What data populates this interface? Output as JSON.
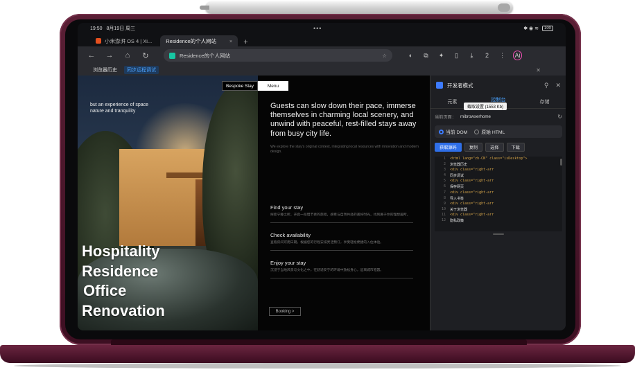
{
  "status": {
    "time": "19:50",
    "date": "8月19日 周三",
    "dots": "•••",
    "signal": "✱ ◉ ≋",
    "battery": "100"
  },
  "tabs": [
    {
      "label": "小米澎湃 OS 4 | Xi...",
      "active": false
    },
    {
      "label": "Residence的个人网站",
      "active": true
    }
  ],
  "toolbar": {
    "url": "Residence的个人网站",
    "icons": [
      "←",
      "→",
      "⌂",
      "↻"
    ],
    "ai_label": "Ai"
  },
  "bookmarks": {
    "items": [
      "浏览器历史",
      "同步远程调试"
    ]
  },
  "hero": {
    "caption_1": "but an experience of space",
    "caption_2": "nature and tranquility",
    "words": [
      "Hospitality",
      "Residence",
      "Office",
      "Renovation"
    ]
  },
  "page_nav": {
    "bespoke": "Bespoke Stay",
    "menu": "Menu"
  },
  "content": {
    "headline": "Guests can slow down their pace, immerse themselves in charming local scenery, and unwind with peaceful, rest-filled stays away from busy city life.",
    "subcopy": "We explore the stay's original context, integrating local resources with innovation and modern design.",
    "features": [
      {
        "title": "Find your stay",
        "desc": "探索宁静之所，开启一段慢节奏的旅程，感受与自然共处的美好时光，找到属于你的理想居所。"
      },
      {
        "title": "Check availability",
        "desc": "查看房间可用日期，根据您的行程安排灵活预订，享受轻松便捷的入住体验。"
      },
      {
        "title": "Enjoy your stay",
        "desc": "沉浸于当地风景与文化之中，在舒适安宁的环境中放松身心，远离城市喧嚣。"
      }
    ],
    "booking": "Booking >"
  },
  "devtools": {
    "title": "开发者模式",
    "tabs": [
      "元素",
      "控制台",
      "存储"
    ],
    "tooltip": "截取设置 (1553 Kb)",
    "url_label": "当前页面：",
    "url_value": "mibrowserhome",
    "radio_dom": "当前 DOM",
    "radio_html": "原始 HTML",
    "actions": [
      "获取源码",
      "复制",
      "选择",
      "下载"
    ],
    "code_lines": [
      {
        "n": "1",
        "t": "<html lang=\"zh-CN\" class=\"isDesktop\">",
        "k": "tg"
      },
      {
        "n": "2",
        "t": "        浏览器历史",
        "k": "cn"
      },
      {
        "n": "3",
        "t": "      <div class=\"right-arr",
        "k": "tg"
      },
      {
        "n": "4",
        "t": "      同步调试",
        "k": "cn"
      },
      {
        "n": "5",
        "t": "      <div class=\"right-arr",
        "k": "tg"
      },
      {
        "n": "6",
        "t": "      保存网页",
        "k": "cn"
      },
      {
        "n": "7",
        "t": "      <div class=\"right-arr",
        "k": "tg"
      },
      {
        "n": "8",
        "t": "      导入书签",
        "k": "cn"
      },
      {
        "n": "9",
        "t": "      <div class=\"right-arr",
        "k": "tg"
      },
      {
        "n": "10",
        "t": "      关于浏览器",
        "k": "cn"
      },
      {
        "n": "11",
        "t": "      <div class=\"right-arr",
        "k": "tg"
      },
      {
        "n": "12",
        "t": "      隐私政策",
        "k": "cn"
      }
    ]
  }
}
